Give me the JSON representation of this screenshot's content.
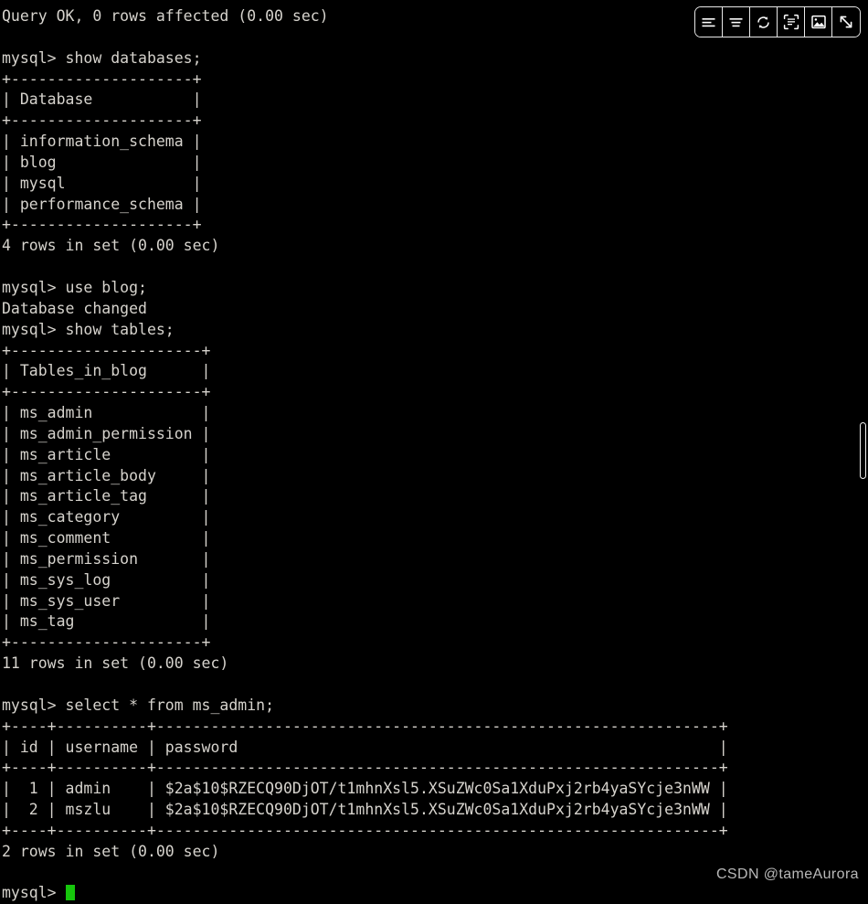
{
  "terminal": {
    "prompt": "mysql>",
    "lines": [
      "Query OK, 0 rows affected (0.00 sec)",
      "",
      "mysql> show databases;",
      "+--------------------+",
      "| Database           |",
      "+--------------------+",
      "| information_schema |",
      "| blog               |",
      "| mysql              |",
      "| performance_schema |",
      "+--------------------+",
      "4 rows in set (0.00 sec)",
      "",
      "mysql> use blog;",
      "Database changed",
      "mysql> show tables;",
      "+---------------------+",
      "| Tables_in_blog      |",
      "+---------------------+",
      "| ms_admin            |",
      "| ms_admin_permission |",
      "| ms_article          |",
      "| ms_article_body     |",
      "| ms_article_tag      |",
      "| ms_category         |",
      "| ms_comment          |",
      "| ms_permission       |",
      "| ms_sys_log          |",
      "| ms_sys_user         |",
      "| ms_tag              |",
      "+---------------------+",
      "11 rows in set (0.00 sec)",
      "",
      "mysql> select * from ms_admin;",
      "+----+----------+--------------------------------------------------------------+",
      "| id | username | password                                                     |",
      "+----+----------+--------------------------------------------------------------+",
      "|  1 | admin    | $2a$10$RZECQ90DjOT/t1mhnXsl5.XSuZWc0Sa1XduPxj2rb4yaSYcje3nWW |",
      "|  2 | mszlu    | $2a$10$RZECQ90DjOT/t1mhnXsl5.XSuZWc0Sa1XduPxj2rb4yaSYcje3nWW |",
      "+----+----------+--------------------------------------------------------------+",
      "2 rows in set (0.00 sec)",
      ""
    ],
    "last_prompt": "mysql> "
  },
  "commands": [
    "show databases;",
    "use blog;",
    "show tables;",
    "select * from ms_admin;"
  ],
  "results": {
    "databases": {
      "column": "Database",
      "rows": [
        "information_schema",
        "blog",
        "mysql",
        "performance_schema"
      ],
      "status": "4 rows in set (0.00 sec)"
    },
    "use_blog_status": "Database changed",
    "tables": {
      "column": "Tables_in_blog",
      "rows": [
        "ms_admin",
        "ms_admin_permission",
        "ms_article",
        "ms_article_body",
        "ms_article_tag",
        "ms_category",
        "ms_comment",
        "ms_permission",
        "ms_sys_log",
        "ms_sys_user",
        "ms_tag"
      ],
      "status": "11 rows in set (0.00 sec)"
    },
    "ms_admin": {
      "columns": [
        "id",
        "username",
        "password"
      ],
      "rows": [
        [
          "1",
          "admin",
          "$2a$10$RZECQ90DjOT/t1mhnXsl5.XSuZWc0Sa1XduPxj2rb4yaSYcje3nWW"
        ],
        [
          "2",
          "mszlu",
          "$2a$10$RZECQ90DjOT/t1mhnXsl5.XSuZWc0Sa1XduPxj2rb4yaSYcje3nWW"
        ]
      ],
      "status": "2 rows in set (0.00 sec)"
    },
    "initial_status": "Query OK, 0 rows affected (0.00 sec)"
  },
  "toolbar": {
    "buttons": [
      {
        "icon": "align-left-icon",
        "label": "Align left"
      },
      {
        "icon": "align-center-icon",
        "label": "Align center"
      },
      {
        "icon": "rotate-icon",
        "label": "Rotate"
      },
      {
        "icon": "scan-text-icon",
        "label": "Extract text"
      },
      {
        "icon": "image-icon",
        "label": "Image"
      },
      {
        "icon": "expand-diagonal-icon",
        "label": "Expand"
      }
    ]
  },
  "watermark": {
    "text": "CSDN @tameAurora"
  },
  "colors": {
    "background": "#000000",
    "foreground": "#d6d3cd",
    "cursor": "#16c60c",
    "watermark": "#b9b9b9",
    "toolbar_border": "#e8e8e8"
  }
}
